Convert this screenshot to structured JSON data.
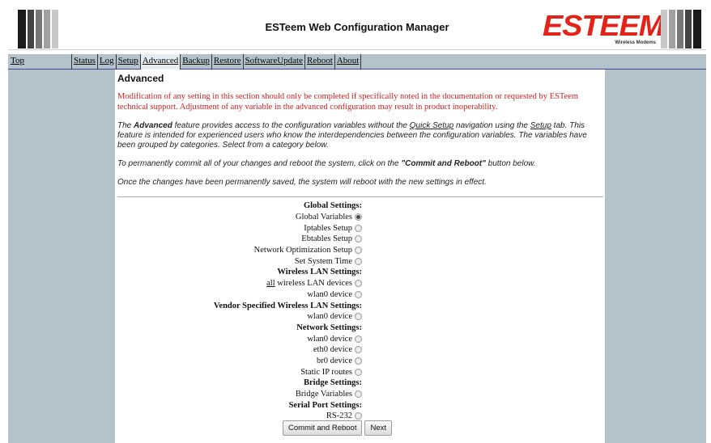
{
  "header": {
    "title": "ESTeem Web Configuration Manager",
    "logo_text": "ESTEEM",
    "logo_subtitle": "Wireless Modems"
  },
  "nav": {
    "top": "Top",
    "tabs": [
      "Status",
      "Log",
      "Setup",
      "Advanced",
      "Backup",
      "Restore",
      "SoftwareUpdate",
      "Reboot",
      "About"
    ],
    "active_tab": "Advanced"
  },
  "content": {
    "title": "Advanced",
    "warning": "Modification of any setting in this section should only be completed if specifically noted in the documentation or requested by ESTeem technical support. Adjustment of any variable in the advanced configuration may result in product inoperability.",
    "p1_a": "The ",
    "p1_bold": "Advanced",
    "p1_b": " feature provides access to the configuration variables without the ",
    "p1_link1": "Quick Setup",
    "p1_c": " navigation using the ",
    "p1_link2": "Setup",
    "p1_d": " tab. This feature is intended for experienced users who know the interdependencies between the configuration variables. The variables have been grouped by categories. Select from a category below.",
    "p2_a": "To permanently commit all of your changes and reboot the system, click on the ",
    "p2_bold": "\"Commit and Reboot\"",
    "p2_b": " button below.",
    "p3": "Once the changes have been permanently saved, the system will reboot with the new settings in effect."
  },
  "settings": {
    "global_header": "Global Settings:",
    "global_variables": "Global Variables",
    "iptables": "Iptables Setup",
    "ebtables": "Ebtables Setup",
    "network_opt": "Network Optimization Setup",
    "system_time": "Set System Time",
    "wlan_header": "Wireless LAN Settings:",
    "all_link": "all",
    "all_rest": " wireless LAN devices",
    "wlan0": "wlan0 device",
    "vendor_header": "Vendor Specified Wireless LAN Settings:",
    "vendor_wlan0": "wlan0 device",
    "network_header": "Network Settings:",
    "net_wlan0": "wlan0 device",
    "net_eth0": "eth0 device",
    "net_br0": "br0 device",
    "net_static": "Static IP routes",
    "bridge_header": "Bridge Settings:",
    "bridge_vars": "Bridge Variables",
    "serial_header": "Serial Port Settings:",
    "rs232": "RS-232",
    "selected": "Global Variables"
  },
  "buttons": {
    "commit": "Commit and Reboot",
    "next": "Next"
  },
  "colors": {
    "panel_bg": "#b4c3c9",
    "logo_red": "#e2231a",
    "warning_red": "#cc2222"
  }
}
